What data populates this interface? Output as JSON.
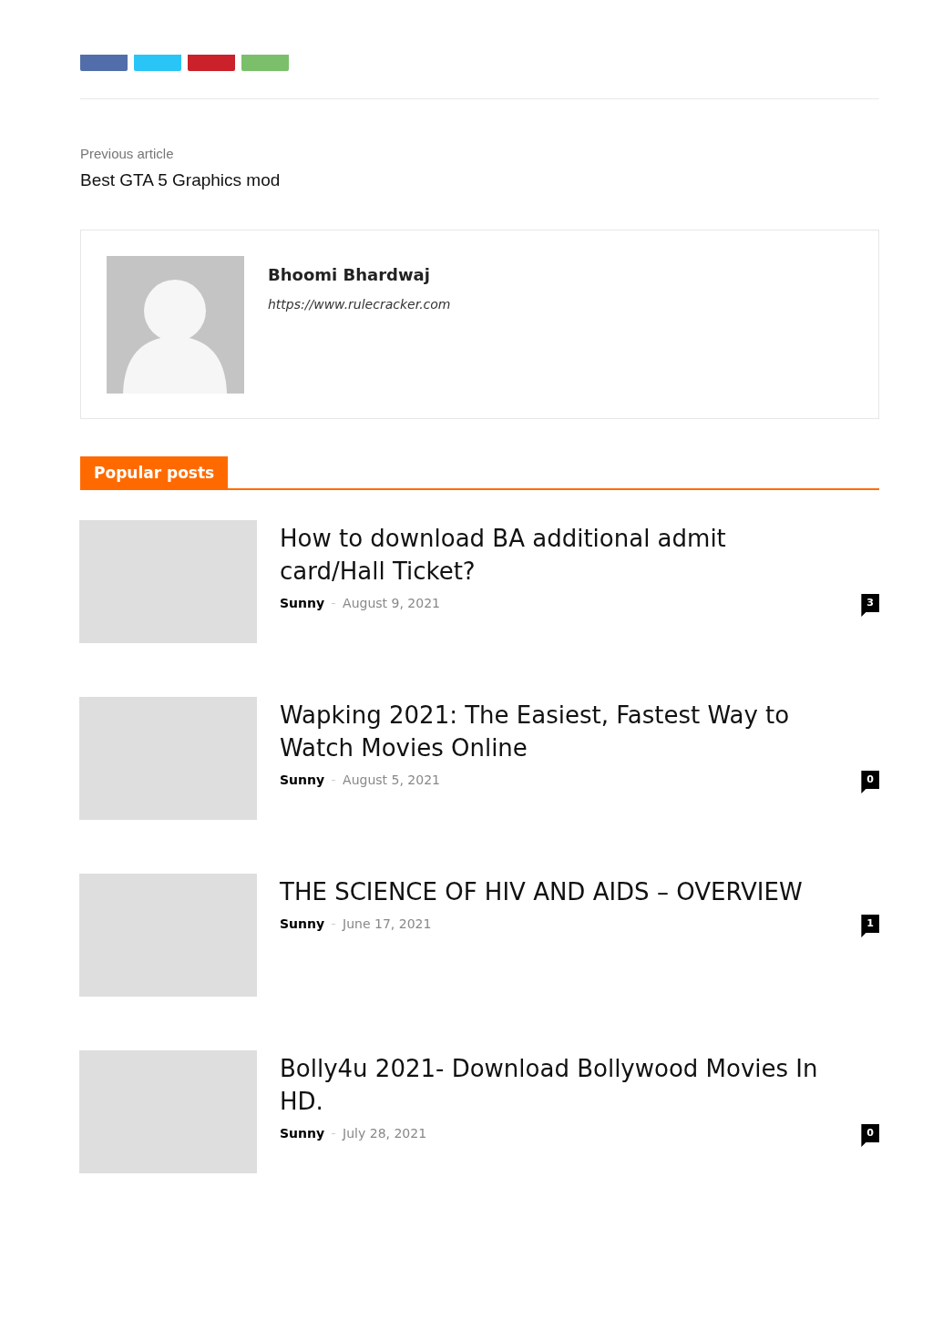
{
  "share_buttons": [
    {
      "color": "#516eab"
    },
    {
      "color": "#29c5f6"
    },
    {
      "color": "#ca212a"
    },
    {
      "color": "#7bbf6a"
    }
  ],
  "previous_article": {
    "label": "Previous article",
    "title": "Best GTA 5 Graphics mod"
  },
  "author": {
    "name": "Bhoomi Bhardwaj",
    "url": "https://www.rulecracker.com"
  },
  "popular_posts": {
    "heading": "Popular posts",
    "posts": [
      {
        "title": "How to download BA additional admit card/Hall Ticket?",
        "author": "Sunny",
        "date": "August 9, 2021",
        "comments": "3"
      },
      {
        "title": "Wapking 2021: The Easiest, Fastest Way to Watch Movies Online",
        "author": "Sunny",
        "date": "August 5, 2021",
        "comments": "0"
      },
      {
        "title": "THE SCIENCE OF HIV AND AIDS – OVERVIEW",
        "author": "Sunny",
        "date": "June 17, 2021",
        "comments": "1"
      },
      {
        "title": "Bolly4u 2021- Download Bollywood Movies In HD.",
        "author": "Sunny",
        "date": "July 28, 2021",
        "comments": "0"
      }
    ]
  }
}
